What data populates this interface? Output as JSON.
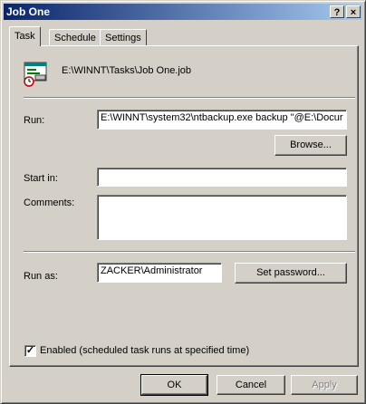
{
  "window": {
    "title": "Job One"
  },
  "titlebar_buttons": {
    "help": "?",
    "close": "×"
  },
  "tabs": [
    {
      "label": "Task",
      "active": true
    },
    {
      "label": "Schedule",
      "active": false
    },
    {
      "label": "Settings",
      "active": false
    }
  ],
  "task": {
    "icon": "scheduled-task-icon",
    "path": "E:\\WINNT\\Tasks\\Job One.job",
    "run_label": "Run:",
    "run_value": "E:\\WINNT\\system32\\ntbackup.exe backup \"@E:\\Docur",
    "browse_label": "Browse...",
    "start_in_label": "Start in:",
    "start_in_value": "",
    "comments_label": "Comments:",
    "comments_value": "",
    "run_as_label": "Run as:",
    "run_as_value": "ZACKER\\Administrator",
    "set_password_label": "Set password...",
    "enabled_label": "Enabled (scheduled task runs at specified time)",
    "enabled_checked": true
  },
  "footer": {
    "ok_label": "OK",
    "cancel_label": "Cancel",
    "apply_label": "Apply"
  },
  "colors": {
    "titlebar_start": "#0a246a",
    "titlebar_end": "#a6caf0",
    "face": "#d4d0c8"
  }
}
